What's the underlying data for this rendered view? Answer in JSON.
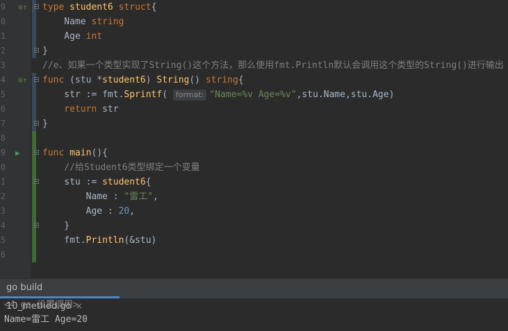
{
  "editor": {
    "line_numbers": [
      "9",
      "0",
      "1",
      "2",
      "3",
      "4",
      "5",
      "6",
      "7",
      "8",
      "9",
      "0",
      "1",
      "2",
      "3",
      "4",
      "5",
      "6"
    ],
    "lines": [
      {
        "tokens": [
          [
            "kw",
            "type "
          ],
          [
            "tn",
            "student6 "
          ],
          [
            "kw",
            "struct"
          ],
          [
            "var",
            "{"
          ]
        ]
      },
      {
        "tokens": [
          [
            "var",
            "    Name "
          ],
          [
            "kw",
            "string"
          ]
        ]
      },
      {
        "tokens": [
          [
            "var",
            "    Age "
          ],
          [
            "kw",
            "int"
          ]
        ]
      },
      {
        "tokens": [
          [
            "var",
            "}"
          ]
        ]
      },
      {
        "tokens": [
          [
            "cm",
            "//e、如果一个类型实现了String()这个方法，那么使用fmt.Println默认会调用这个类型的String()进行输出"
          ]
        ]
      },
      {
        "tokens": [
          [
            "kw",
            "func "
          ],
          [
            "var",
            "("
          ],
          [
            "var",
            "stu "
          ],
          [
            "var",
            "*"
          ],
          [
            "tn",
            "student6"
          ],
          [
            "var",
            ") "
          ],
          [
            "fn",
            "String"
          ],
          [
            "var",
            "() "
          ],
          [
            "kw",
            "string"
          ],
          [
            "var",
            "{"
          ]
        ]
      },
      {
        "tokens": [
          [
            "var",
            "    str := fmt."
          ],
          [
            "fn",
            "Sprintf"
          ],
          [
            "var",
            "( "
          ],
          [
            "hint",
            "format:"
          ],
          [
            "str",
            "\"Name=%v Age=%v\""
          ],
          [
            "var",
            ",stu.Name,stu.Age)"
          ]
        ]
      },
      {
        "tokens": [
          [
            "kw",
            "    return "
          ],
          [
            "var",
            "str"
          ]
        ]
      },
      {
        "tokens": [
          [
            "var",
            "}"
          ]
        ]
      },
      {
        "tokens": []
      },
      {
        "tokens": [
          [
            "kw",
            "func "
          ],
          [
            "fn",
            "main"
          ],
          [
            "var",
            "(){"
          ]
        ]
      },
      {
        "tokens": [
          [
            "cm",
            "    //给Student6类型绑定一个变量"
          ]
        ]
      },
      {
        "tokens": [
          [
            "var",
            "    stu := "
          ],
          [
            "tn",
            "student6"
          ],
          [
            "var",
            "{"
          ]
        ]
      },
      {
        "tokens": [
          [
            "var",
            "        Name : "
          ],
          [
            "str",
            "\"雷工\""
          ],
          [
            "var",
            ","
          ]
        ]
      },
      {
        "tokens": [
          [
            "var",
            "        Age : "
          ],
          [
            "num",
            "20"
          ],
          [
            "var",
            ","
          ]
        ]
      },
      {
        "tokens": [
          [
            "var",
            "    }"
          ]
        ]
      },
      {
        "tokens": [
          [
            "var",
            "    fmt."
          ],
          [
            "fn",
            "Println"
          ],
          [
            "var",
            "(&stu)"
          ]
        ]
      },
      {
        "tokens": []
      }
    ]
  },
  "run_panel": {
    "tab_label": "go build 10_method.go",
    "close_glyph": "×",
    "output": [
      "<4 go 设置调用>",
      "Name=雷工 Age=20"
    ]
  }
}
